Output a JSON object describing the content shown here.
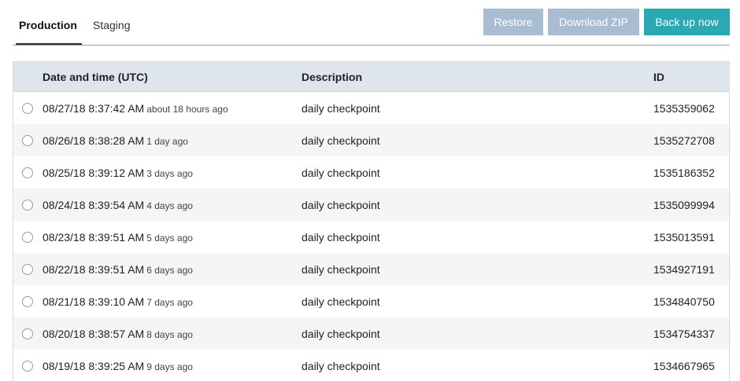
{
  "tabs": [
    {
      "label": "Production",
      "active": true
    },
    {
      "label": "Staging",
      "active": false
    }
  ],
  "toolbar": {
    "restore_label": "Restore",
    "download_label": "Download ZIP",
    "backup_label": "Back up now"
  },
  "colors": {
    "disabled_button": "#a8bdd1",
    "primary_button": "#2aa8b3",
    "header_bg": "#dfe5ec"
  },
  "table": {
    "columns": [
      "Date and time (UTC)",
      "Description",
      "ID"
    ],
    "rows": [
      {
        "datetime": "08/27/18 8:37:42 AM",
        "relative": "about 18 hours ago",
        "description": "daily checkpoint",
        "id": "1535359062"
      },
      {
        "datetime": "08/26/18 8:38:28 AM",
        "relative": "1 day ago",
        "description": "daily checkpoint",
        "id": "1535272708"
      },
      {
        "datetime": "08/25/18 8:39:12 AM",
        "relative": "3 days ago",
        "description": "daily checkpoint",
        "id": "1535186352"
      },
      {
        "datetime": "08/24/18 8:39:54 AM",
        "relative": "4 days ago",
        "description": "daily checkpoint",
        "id": "1535099994"
      },
      {
        "datetime": "08/23/18 8:39:51 AM",
        "relative": "5 days ago",
        "description": "daily checkpoint",
        "id": "1535013591"
      },
      {
        "datetime": "08/22/18 8:39:51 AM",
        "relative": "6 days ago",
        "description": "daily checkpoint",
        "id": "1534927191"
      },
      {
        "datetime": "08/21/18 8:39:10 AM",
        "relative": "7 days ago",
        "description": "daily checkpoint",
        "id": "1534840750"
      },
      {
        "datetime": "08/20/18 8:38:57 AM",
        "relative": "8 days ago",
        "description": "daily checkpoint",
        "id": "1534754337"
      },
      {
        "datetime": "08/19/18 8:39:25 AM",
        "relative": "9 days ago",
        "description": "daily checkpoint",
        "id": "1534667965"
      }
    ]
  }
}
